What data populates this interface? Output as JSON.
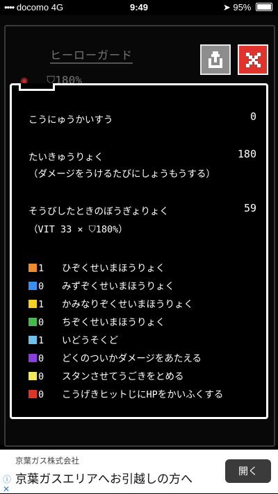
{
  "status_bar": {
    "carrier": "docomo",
    "network": "4G",
    "time": "9:49",
    "battery": "95%"
  },
  "background": {
    "title": "ヒーローガード",
    "stat_text": "180%"
  },
  "buttons": {
    "share_icon": "share-upload-icon",
    "close_icon": "close-x-icon",
    "share_color": "#8d8d8d",
    "close_color": "#e0332b"
  },
  "dialog": {
    "lines": [
      {
        "label": "こうにゅうかいすう",
        "value": "0"
      },
      {
        "label": "たいきゅうりょく",
        "value": "180"
      },
      {
        "label": "（ダメージをうけるたびにしょうもうする）",
        "value": ""
      },
      {
        "label": "そうびしたときのぼうぎょりょく",
        "value": "59"
      },
      {
        "label": "（VIT 33 × ⛉180%）",
        "value": ""
      }
    ],
    "resistances": [
      {
        "icon": "fire-icon",
        "color": "#f08a2a",
        "num": "1",
        "text": "ひぞくせいまほうりょく"
      },
      {
        "icon": "water-icon",
        "color": "#3a8ff2",
        "num": "0",
        "text": "みずぞくせいまほうりょく"
      },
      {
        "icon": "lightning-icon",
        "color": "#f5d023",
        "num": "1",
        "text": "かみなりぞくせいまほうりょく"
      },
      {
        "icon": "earth-icon",
        "color": "#48b84a",
        "num": "0",
        "text": "ちぞくせいまほうりょく"
      },
      {
        "icon": "boot-icon",
        "color": "#6ec1ea",
        "num": "1",
        "text": "いどうそくど"
      },
      {
        "icon": "poison-icon",
        "color": "#8a3ee0",
        "num": "0",
        "text": "どくのついかダメージをあたえる"
      },
      {
        "icon": "stun-icon",
        "color": "#f2e85a",
        "num": "0",
        "text": "スタンさせてうごきをとめる"
      },
      {
        "icon": "heart-drain-icon",
        "color": "#e0332b",
        "num": "0",
        "text": "こうげきヒットじにHPをかいふくする"
      }
    ]
  },
  "ad": {
    "company": "京葉ガス株式会社",
    "headline": "京葉ガスエリアへお引越しの方へ",
    "button": "開く"
  }
}
